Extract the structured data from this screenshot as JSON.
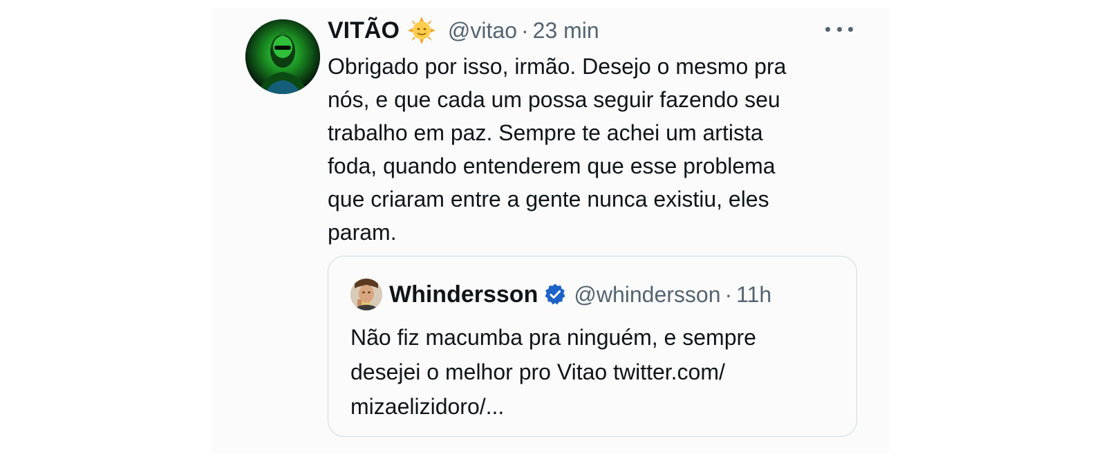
{
  "tweet": {
    "display_name": "VITÃO",
    "name_emoji": "sun-with-face-emoji",
    "handle": "@vitao",
    "separator": "·",
    "time": "23 min",
    "text": "Obrigado por isso, irmão. Desejo o mesmo pra\nnós, e que cada um possa seguir fazendo seu\ntrabalho em paz. Sempre te achei um artista\nfoda, quando entenderem que esse problema\nque criaram entre a gente nunca existiu, eles\nparam."
  },
  "quoted_tweet": {
    "display_name": "Whindersson",
    "verified_icon": "verified-badge-icon",
    "handle": "@whindersson",
    "separator": "·",
    "time": "11h",
    "text": "Não fiz macumba pra ninguém, e sempre\ndesejei o melhor pro Vitao twitter.com/\nmizaelizidoro/..."
  },
  "colors": {
    "text_primary": "#0f1419",
    "text_secondary": "#536471",
    "border": "#cfd9de",
    "verified_blue": "#1d63c7",
    "card_background": "#fbfbfc"
  }
}
